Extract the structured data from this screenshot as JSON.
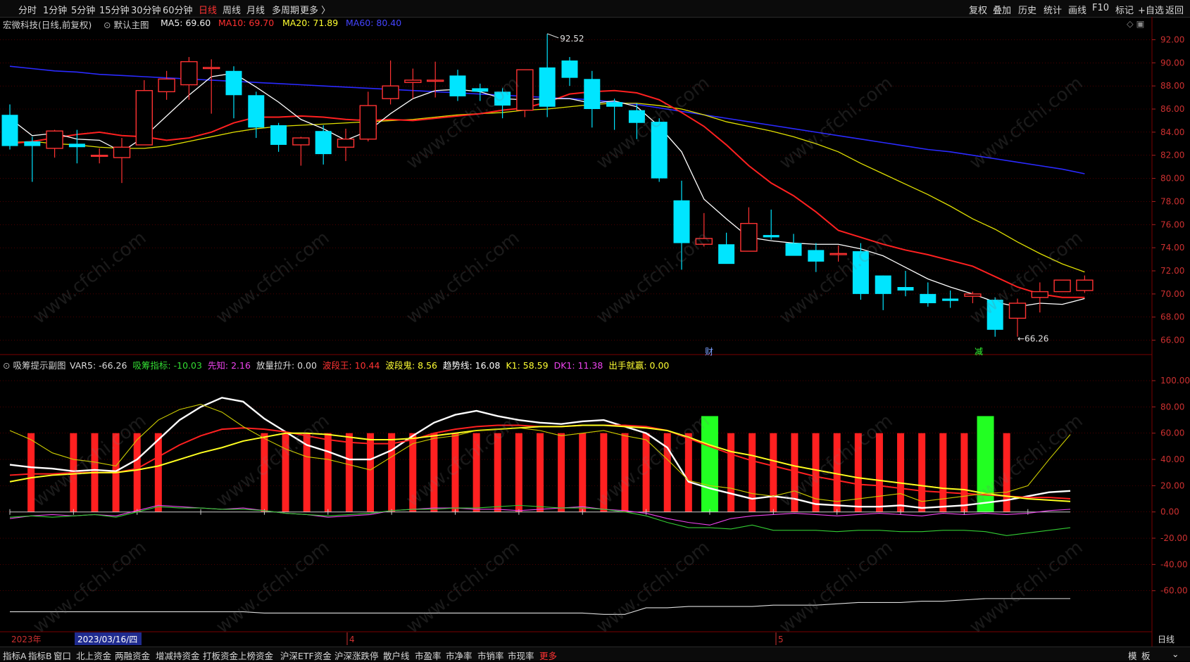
{
  "toolbar": {
    "periods": [
      "分时",
      "1分钟",
      "5分钟",
      "15分钟",
      "30分钟",
      "60分钟",
      "日线",
      "周线",
      "月线",
      "多周期",
      "更多 〉"
    ],
    "active_period": "日线",
    "right_items": [
      "复权",
      "叠加",
      "历史",
      "统计",
      "画线",
      "F10",
      "标记",
      "+自选",
      "返回"
    ]
  },
  "main_info": {
    "title": "宏微科技(日线,前复权)",
    "chart_name": "默认主图",
    "ma5": "MA5: 69.60",
    "ma10": "MA10: 69.70",
    "ma20": "MA20: 71.89",
    "ma60": "MA60: 80.40"
  },
  "sub_info": {
    "title": "吸筹提示副图",
    "items": [
      {
        "text": "VAR5: -66.26",
        "color": "#dddddd"
      },
      {
        "text": "吸筹指标: -10.03",
        "color": "#33dd33"
      },
      {
        "text": "先知: 2.16",
        "color": "#ee44ee"
      },
      {
        "text": "放量拉升: 0.00",
        "color": "#dddddd"
      },
      {
        "text": "波段王: 10.44",
        "color": "#ff3333"
      },
      {
        "text": "波段鬼: 8.56",
        "color": "#ffff33"
      },
      {
        "text": "趋势线: 16.08",
        "color": "#ffffff"
      },
      {
        "text": "K1: 58.59",
        "color": "#ffff33"
      },
      {
        "text": "DK1: 11.38",
        "color": "#ee44ee"
      },
      {
        "text": "出手就赢: 0.00",
        "color": "#ffff33"
      }
    ]
  },
  "annotations": {
    "high": "92.52",
    "low": "66.26",
    "cai": "财",
    "jian": "减"
  },
  "watermark": "www.cfchi.com",
  "date_axis": {
    "year": "2023年",
    "selected": "2023/03/16/四",
    "m4": "4",
    "m5": "5"
  },
  "right_label": "日线",
  "bottom_tabs": [
    "指标A",
    "指标B",
    "窗口",
    "北上资金",
    "两融资金",
    "增减持资金",
    "打板资金",
    "上榜资金",
    "沪深ETF资金",
    "沪深涨跌停",
    "散户线",
    "市盈率",
    "市净率",
    "市销率",
    "市现率",
    "更多"
  ],
  "bottom_active": "更多",
  "bottom_right": [
    "模",
    "板",
    "⌄"
  ],
  "colors": {
    "up": "#ff3232",
    "down": "#00e5ff",
    "ma5": "#ffffff",
    "ma10": "#ff2020",
    "ma20": "#e0e000",
    "ma60": "#2a2aff",
    "grid": "#7a0000"
  },
  "chart_data": [
    {
      "type": "candlestick",
      "title": "宏微科技(日线,前复权)",
      "ylim": [
        65,
        93
      ],
      "yticks": [
        66,
        68,
        70,
        72,
        74,
        76,
        78,
        80,
        82,
        84,
        86,
        88,
        90,
        92
      ],
      "ohlc": [
        [
          85.5,
          86.4,
          82.5,
          82.8
        ],
        [
          83.2,
          83.6,
          79.7,
          82.8
        ],
        [
          82.6,
          84.2,
          81.8,
          84.1
        ],
        [
          83.0,
          84.2,
          81.3,
          82.7
        ],
        [
          82.0,
          82.6,
          81.3,
          82.0
        ],
        [
          81.8,
          83.5,
          79.6,
          82.7
        ],
        [
          82.9,
          88.5,
          82.9,
          87.6
        ],
        [
          87.5,
          89.3,
          86.8,
          88.6
        ],
        [
          88.1,
          90.5,
          86.8,
          90.1
        ],
        [
          89.5,
          90.3,
          85.6,
          89.6
        ],
        [
          89.3,
          89.7,
          85.2,
          87.2
        ],
        [
          87.2,
          87.5,
          83.5,
          84.4
        ],
        [
          84.6,
          84.8,
          82.3,
          82.9
        ],
        [
          82.9,
          83.6,
          81.1,
          83.5
        ],
        [
          84.1,
          84.6,
          81.2,
          82.1
        ],
        [
          82.7,
          84.3,
          81.5,
          83.4
        ],
        [
          83.4,
          87.5,
          83.2,
          86.3
        ],
        [
          86.9,
          90.2,
          86.4,
          88.0
        ],
        [
          88.3,
          89.5,
          86.9,
          88.5
        ],
        [
          88.4,
          90.1,
          87.0,
          88.5
        ],
        [
          88.9,
          89.4,
          86.7,
          87.1
        ],
        [
          87.8,
          88.2,
          86.7,
          87.5
        ],
        [
          87.5,
          87.8,
          85.2,
          86.3
        ],
        [
          85.9,
          88.1,
          85.3,
          89.4
        ],
        [
          89.6,
          92.5,
          85.3,
          86.2
        ],
        [
          90.2,
          90.5,
          88.0,
          88.7
        ],
        [
          88.6,
          89.3,
          84.4,
          86.0
        ],
        [
          86.6,
          86.9,
          84.2,
          86.2
        ],
        [
          85.9,
          86.5,
          83.4,
          84.8
        ],
        [
          84.9,
          85.2,
          79.7,
          80.0
        ],
        [
          78.1,
          79.8,
          72.1,
          74.4
        ],
        [
          74.3,
          77.0,
          74.1,
          74.8
        ],
        [
          74.3,
          75.3,
          72.8,
          72.6
        ],
        [
          73.7,
          77.5,
          73.7,
          76.1
        ],
        [
          75.1,
          77.3,
          74.7,
          74.9
        ],
        [
          74.4,
          75.2,
          73.6,
          73.3
        ],
        [
          73.8,
          74.4,
          71.9,
          72.8
        ],
        [
          73.4,
          74.2,
          72.8,
          73.5
        ],
        [
          73.7,
          74.4,
          69.5,
          70.0
        ],
        [
          71.6,
          71.6,
          68.6,
          70.0
        ],
        [
          70.6,
          72.0,
          69.8,
          70.3
        ],
        [
          70.0,
          71.0,
          68.9,
          69.2
        ],
        [
          69.6,
          70.3,
          68.8,
          69.4
        ],
        [
          69.8,
          70.2,
          69.2,
          70.0
        ],
        [
          69.5,
          69.7,
          66.3,
          66.9
        ],
        [
          67.9,
          69.6,
          66.3,
          69.2
        ],
        [
          69.7,
          71.0,
          68.4,
          70.2
        ],
        [
          70.2,
          71.2,
          70.2,
          71.2
        ],
        [
          70.3,
          71.6,
          70.1,
          71.2
        ]
      ],
      "ma5": [
        85.2,
        83.7,
        83.9,
        83.4,
        83.3,
        82.3,
        83.6,
        85.4,
        87.2,
        88.8,
        89.1,
        87.9,
        86.6,
        85.1,
        84.3,
        83.3,
        84.1,
        85.6,
        86.9,
        87.6,
        87.7,
        87.5,
        86.9,
        86.8,
        86.9,
        86.9,
        86.5,
        86.7,
        86.2,
        84.5,
        82.3,
        78.2,
        76.5,
        74.9,
        74.6,
        74.4,
        74.3,
        74.3,
        73.9,
        73.3,
        72.3,
        71.3,
        70.6,
        70.0,
        69.3,
        68.9,
        69.2,
        69.1,
        69.6
      ],
      "ma10": [
        83.0,
        83.2,
        83.5,
        83.8,
        84.0,
        83.7,
        83.6,
        83.3,
        83.5,
        84.0,
        84.8,
        85.3,
        85.3,
        85.4,
        85.3,
        85.1,
        85.0,
        85.1,
        85.0,
        85.2,
        85.4,
        85.6,
        85.9,
        86.1,
        86.6,
        87.3,
        87.5,
        87.6,
        87.4,
        86.8,
        85.7,
        84.5,
        82.9,
        81.1,
        79.6,
        78.5,
        77.1,
        75.5,
        74.9,
        74.3,
        73.8,
        73.4,
        72.9,
        72.4,
        71.5,
        70.6,
        70.0,
        69.7,
        69.7
      ],
      "ma20": [
        83.1,
        83.2,
        83.0,
        82.9,
        82.7,
        82.6,
        82.6,
        82.8,
        83.2,
        83.6,
        84.0,
        84.3,
        84.5,
        84.6,
        84.7,
        84.8,
        84.9,
        85.0,
        85.1,
        85.3,
        85.5,
        85.6,
        85.7,
        85.9,
        86.0,
        86.2,
        86.4,
        86.5,
        86.5,
        86.3,
        86.0,
        85.5,
        84.9,
        84.5,
        84.1,
        83.6,
        83.0,
        82.3,
        81.3,
        80.4,
        79.5,
        78.6,
        77.6,
        76.5,
        75.6,
        74.5,
        73.5,
        72.6,
        71.9
      ],
      "ma60": [
        89.7,
        89.5,
        89.3,
        89.2,
        89.0,
        88.9,
        88.8,
        88.7,
        88.6,
        88.5,
        88.4,
        88.3,
        88.2,
        88.1,
        88.0,
        87.9,
        87.8,
        87.7,
        87.6,
        87.5,
        87.4,
        87.3,
        87.2,
        87.1,
        87.0,
        86.9,
        86.8,
        86.6,
        86.4,
        86.1,
        85.8,
        85.5,
        85.2,
        84.9,
        84.6,
        84.3,
        84.0,
        83.7,
        83.4,
        83.1,
        82.8,
        82.5,
        82.3,
        82.0,
        81.7,
        81.4,
        81.1,
        80.8,
        80.4
      ],
      "high_label": 92.52,
      "low_label": 66.26
    },
    {
      "type": "indicator",
      "title": "吸筹提示副图",
      "ylim": [
        -80,
        107
      ],
      "yticks": [
        100,
        80,
        60,
        40,
        20,
        0,
        -20,
        -40,
        -60
      ],
      "series": [
        {
          "name": "趋势线",
          "values": [
            36,
            34,
            33,
            31,
            32,
            31,
            40,
            55,
            70,
            80,
            87,
            84,
            71,
            61,
            51,
            46,
            40,
            40,
            47,
            58,
            68,
            74,
            77,
            73,
            70,
            68,
            67,
            69,
            70,
            65,
            60,
            49,
            23,
            18,
            14,
            10,
            12,
            10,
            6,
            5,
            4,
            4,
            5,
            3,
            4,
            5,
            7,
            9,
            12,
            15,
            16
          ]
        },
        {
          "name": "波段王",
          "values": [
            28,
            29,
            29,
            30,
            30,
            30,
            33,
            42,
            51,
            58,
            63,
            64,
            63,
            61,
            58,
            55,
            53,
            52,
            52,
            55,
            60,
            63,
            65,
            66,
            66,
            65,
            65,
            66,
            66,
            66,
            65,
            62,
            56,
            50,
            44,
            39,
            35,
            31,
            27,
            24,
            21,
            20,
            18,
            16,
            15,
            14,
            13,
            12,
            11,
            11,
            10
          ]
        },
        {
          "name": "波段鬼",
          "values": [
            23,
            26,
            28,
            29,
            30,
            30,
            32,
            35,
            40,
            45,
            49,
            54,
            57,
            60,
            60,
            59,
            57,
            55,
            55,
            56,
            58,
            60,
            62,
            63,
            64,
            65,
            65,
            66,
            66,
            65,
            64,
            62,
            57,
            51,
            46,
            43,
            39,
            35,
            32,
            29,
            26,
            24,
            22,
            20,
            18,
            17,
            14,
            12,
            10,
            9,
            8
          ]
        },
        {
          "name": "K1",
          "values": [
            62,
            55,
            45,
            40,
            38,
            35,
            55,
            70,
            78,
            82,
            76,
            65,
            56,
            48,
            42,
            40,
            36,
            32,
            42,
            52,
            56,
            58,
            62,
            63,
            64,
            62,
            58,
            60,
            62,
            58,
            55,
            40,
            24,
            20,
            18,
            14,
            12,
            16,
            10,
            8,
            10,
            12,
            14,
            8,
            10,
            12,
            14,
            15,
            20,
            40,
            59
          ]
        },
        {
          "name": "先知",
          "values": [
            -5,
            -3,
            -2,
            -3,
            -2,
            -3,
            1,
            5,
            4,
            3,
            2,
            3,
            1,
            -1,
            -2,
            -4,
            -3,
            -2,
            1,
            2,
            3,
            3,
            2,
            2,
            1,
            2,
            3,
            4,
            2,
            1,
            -1,
            -5,
            -8,
            -10,
            -5,
            -3,
            -2,
            -1,
            -2,
            -3,
            -2,
            -1,
            -2,
            -3,
            -1,
            -2,
            -1,
            -2,
            -1,
            1,
            2
          ]
        },
        {
          "name": "吸筹指标",
          "values": [
            -4,
            -3,
            -4,
            -3,
            -2,
            -4,
            0,
            4,
            3,
            3,
            2,
            2,
            1,
            -1,
            -2,
            -3,
            -2,
            -1,
            1,
            2,
            2,
            3,
            3,
            4,
            5,
            4,
            3,
            3,
            2,
            0,
            -3,
            -8,
            -12,
            -12,
            -13,
            -10,
            -14,
            -14,
            -14,
            -15,
            -14,
            -14,
            -15,
            -15,
            -14,
            -14,
            -15,
            -18,
            -16,
            -14,
            -12
          ]
        },
        {
          "name": "VAR5",
          "values": [
            -76,
            -76,
            -76,
            -76,
            -76,
            -76,
            -76,
            -76,
            -76,
            -76,
            -76,
            -76,
            -77,
            -77,
            -77,
            -77,
            -77,
            -77,
            -77,
            -77,
            -77,
            -77,
            -77,
            -77,
            -77,
            -77,
            -77,
            -77,
            -78,
            -78,
            -73,
            -73,
            -72,
            -72,
            -72,
            -72,
            -71,
            -71,
            -71,
            -70,
            -69,
            -69,
            -69,
            -68,
            -68,
            -67,
            -66,
            -66,
            -66,
            -66,
            -66
          ]
        }
      ],
      "red_bars": [
        1,
        3,
        4,
        5,
        6,
        7,
        12,
        13,
        14,
        15,
        16,
        17,
        18,
        19,
        20,
        21,
        22,
        23,
        24,
        25,
        26,
        27,
        28,
        29,
        30,
        31,
        32,
        33,
        34,
        35,
        36,
        37,
        38,
        39,
        40,
        41,
        42,
        43,
        44,
        45,
        46,
        47
      ],
      "green_bars": [
        33,
        46
      ]
    }
  ]
}
